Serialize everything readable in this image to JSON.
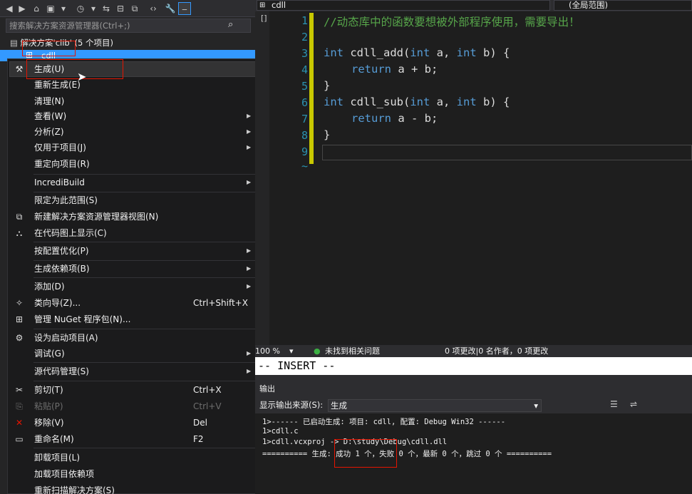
{
  "solution_explorer": {
    "search_placeholder": "搜索解决方案资源管理器(Ctrl+;)",
    "solution_label": "解决方案'clib' (5 个项目)",
    "project_label": "cdll"
  },
  "context_menu": {
    "items": [
      {
        "label": "生成(U)",
        "icon": "build-icon"
      },
      {
        "label": "重新生成(E)"
      },
      {
        "label": "清理(N)"
      },
      {
        "label": "查看(W)",
        "submenu": true
      },
      {
        "label": "分析(Z)",
        "submenu": true
      },
      {
        "label": "仅用于项目(J)",
        "submenu": true
      },
      {
        "label": "重定向项目(R)"
      },
      {
        "label": "IncrediBuild",
        "submenu": true
      },
      {
        "label": "限定为此范围(S)"
      },
      {
        "label": "新建解决方案资源管理器视图(N)",
        "icon": "new-view-icon"
      },
      {
        "label": "在代码图上显示(C)",
        "icon": "code-map-icon"
      },
      {
        "label": "按配置优化(P)",
        "submenu": true
      },
      {
        "label": "生成依赖项(B)",
        "submenu": true
      },
      {
        "label": "添加(D)",
        "submenu": true
      },
      {
        "label": "类向导(Z)...",
        "shortcut": "Ctrl+Shift+X",
        "icon": "class-wizard-icon"
      },
      {
        "label": "管理 NuGet 程序包(N)...",
        "icon": "nuget-icon"
      },
      {
        "label": "设为启动项目(A)",
        "icon": "gear-icon"
      },
      {
        "label": "调试(G)",
        "submenu": true
      },
      {
        "label": "源代码管理(S)",
        "submenu": true
      },
      {
        "label": "剪切(T)",
        "shortcut": "Ctrl+X",
        "icon": "cut-icon"
      },
      {
        "label": "粘贴(P)",
        "shortcut": "Ctrl+V",
        "icon": "paste-icon",
        "disabled": true
      },
      {
        "label": "移除(V)",
        "shortcut": "Del",
        "icon": "remove-icon"
      },
      {
        "label": "重命名(M)",
        "shortcut": "F2",
        "icon": "rename-icon"
      },
      {
        "label": "卸载项目(L)"
      },
      {
        "label": "加载项目依赖项"
      },
      {
        "label": "重新扫描解决方案(S)"
      }
    ]
  },
  "editor": {
    "file_combo": "cdll",
    "scope_combo": "(全局范围)",
    "line_numbers": [
      "1",
      "2",
      "3",
      "4",
      "5",
      "6",
      "7",
      "8",
      "9"
    ],
    "lines": {
      "l1_comment": "//动态库中的函数要想被外部程序使用，需要导出！",
      "l3_kw": "int",
      "l3_fn": " cdll_add(",
      "l3_kw2": "int",
      "l3_a": " a, ",
      "l3_kw3": "int",
      "l3_b": " b) {",
      "l4_kw": "return",
      "l4_rest": " a + b;",
      "l5": "}",
      "l6_kw": "int",
      "l6_fn": " cdll_sub(",
      "l6_kw2": "int",
      "l6_a": " a, ",
      "l6_kw3": "int",
      "l6_b": " b) {",
      "l7_kw": "return",
      "l7_rest": " a - b;",
      "l8": "}"
    }
  },
  "status": {
    "zoom": "100 %",
    "issues": "未找到相关问题",
    "changes": "0 项更改|0 名作者，0 项更改",
    "mode": "-- INSERT --"
  },
  "output": {
    "title": "输出",
    "source_label": "显示输出来源(S):",
    "source_value": "生成",
    "lines": [
      "1>------ 已启动生成: 项目: cdll, 配置: Debug Win32 ------",
      "1>cdll.c",
      "1>cdll.vcxproj -> D:\\study\\Debug\\cdll.dll",
      "========== 生成: 成功 1 个，失败 0 个，最新 0 个，跳过 0 个 =========="
    ]
  }
}
